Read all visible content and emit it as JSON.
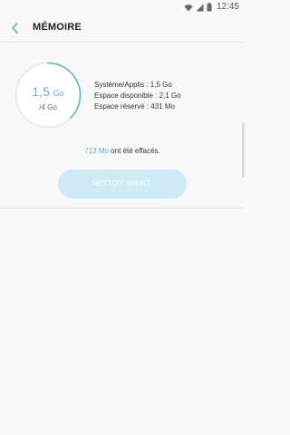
{
  "status_bar": {
    "time": "12:45",
    "icons": [
      "wifi-icon",
      "signal-icon",
      "battery-icon"
    ]
  },
  "header": {
    "title": "MÉMOIRE",
    "back_icon": "chevron-left-icon"
  },
  "storage": {
    "used_value": "1,5",
    "used_unit": "Go",
    "total": "/4 Go",
    "used_fraction": 0.375,
    "details": [
      "Système/Applis : 1,5 Go",
      "Espace disponible : 2,1 Go",
      "Espace réservé : 431 Mo"
    ]
  },
  "cleanup": {
    "freed_amount": "713 Mo",
    "freed_suffix": " ont été effacés.",
    "button_label": "NETTOY. MAINT."
  },
  "colors": {
    "accent": "#5bb4d6",
    "button_bg": "#cdeaf5",
    "background": "#f8f8f8"
  }
}
